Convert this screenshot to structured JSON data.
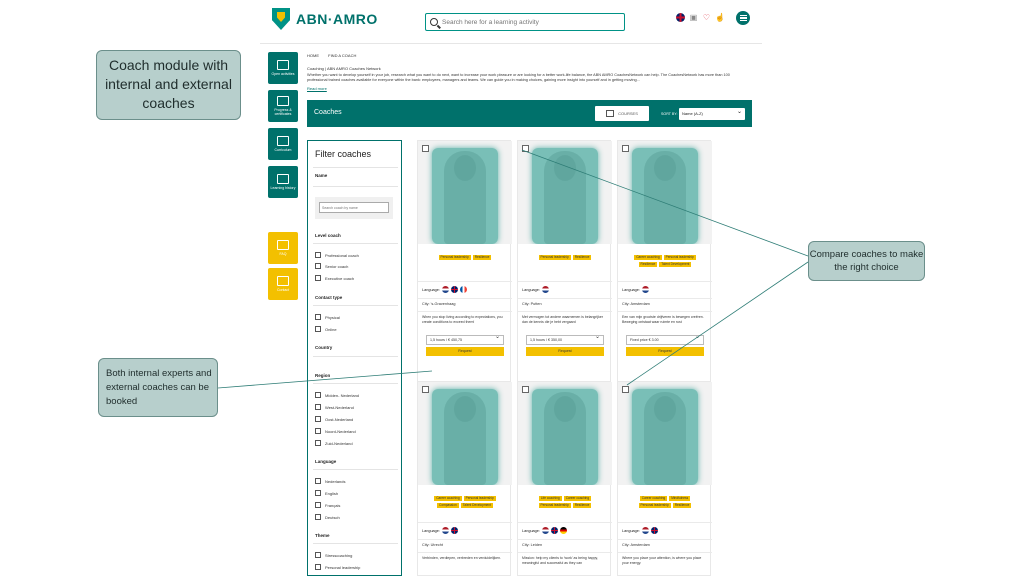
{
  "header": {
    "logo_text": "ABN·AMRO",
    "search_placeholder": "Search here for a learning activity"
  },
  "sidenav": [
    {
      "label": "Open activities"
    },
    {
      "label": "Progress & certificates"
    },
    {
      "label": "Curriculum"
    },
    {
      "label": "Learning history"
    },
    {
      "label": "FAQ"
    },
    {
      "label": "Contact"
    }
  ],
  "breadcrumb": [
    "HOME",
    "FIND A COACH"
  ],
  "intro": {
    "title": "Coaching | ABN AMRO Coaches Network",
    "text": "Whether you want to develop yourself in your job, research what you want to do next, want to increase your work pleasure or are looking for a better work-life balance, the ABN AMRO CoachesNetwork can help. The CoachesNetwork has more than 100 professional trained coaches available for everyone within the bank: employees, managers and teams. We can guide you in making choices, gaining more insight into yourself and in getting moving...",
    "read_more": "Read more"
  },
  "coaches_bar": {
    "title": "Coaches",
    "courses_label": "COURSES",
    "sort_label": "SORT BY:",
    "sort_value": "Name (A-Z)"
  },
  "filter": {
    "title": "Filter coaches",
    "name_label": "Name",
    "name_placeholder": "Search coach by name",
    "level_label": "Level coach",
    "level_options": [
      "Professional coach",
      "Senior coach",
      "Executive coach"
    ],
    "contact_label": "Contact type",
    "contact_options": [
      "Physical",
      "Online"
    ],
    "country_label": "Country",
    "region_label": "Region",
    "region_options": [
      "Midden- Nederland",
      "West-Nederland",
      "Oost-Nederland",
      "Noord-Nederland",
      "Zuid-Nederland"
    ],
    "language_label": "Language",
    "language_options": [
      "Nederlands",
      "English",
      "Français",
      "Deutsch"
    ],
    "theme_label": "Theme",
    "theme_options": [
      "Stresscoaching",
      "Personal leadership"
    ]
  },
  "cards": [
    {
      "tags": [
        "Personal leadership",
        "Resilience"
      ],
      "language_label": "Language:",
      "languages": [
        "nl",
        "en",
        "fr"
      ],
      "city": "City: 's-Gravenhaag",
      "desc": "When you stop living according to expectations, you create conditions to exceed them!",
      "price": "1,5 hours / € 450,75",
      "request": "Request"
    },
    {
      "tags": [
        "Personal leadership",
        "Resilience"
      ],
      "language_label": "Language:",
      "languages": [
        "nl"
      ],
      "city": "City: Putten",
      "desc": "Met vermogen tot andere waarnemen is belangrijker dan de kennis die je hebt vergaard",
      "price": "1,5 hours / € 350,00",
      "request": "Request"
    },
    {
      "tags": [
        "Career coaching",
        "Personal leadership",
        "Resilience",
        "Talent Development"
      ],
      "language_label": "Language:",
      "languages": [
        "nl"
      ],
      "city": "City: Amsterdam",
      "desc": "Een van mijn grootste drijfveren is bewegen creëren. Beweging ontstaat waar ruimte en rust",
      "price": "Fixed price € 3.00",
      "request": "Request"
    },
    {
      "tags": [
        "Career coaching",
        "Personal leadership",
        "Compassion",
        "Talent Development"
      ],
      "language_label": "Language:",
      "languages": [
        "nl",
        "en"
      ],
      "city": "City: Utrecht",
      "desc": "Verbinden, verdiepen, verbreden en verduidelijken.",
      "price": "",
      "request": ""
    },
    {
      "tags": [
        "Life coaching",
        "Career coaching",
        "Personal leadership",
        "Resilience"
      ],
      "language_label": "Language:",
      "languages": [
        "nl",
        "en",
        "de"
      ],
      "city": "City: Leiden",
      "desc": "Mission: help my clients to 'work' as being happy, meaningful and successful as they can",
      "price": "",
      "request": ""
    },
    {
      "tags": [
        "Career coaching",
        "Mindfulness",
        "Personal leadership",
        "Resilience"
      ],
      "language_label": "Language:",
      "languages": [
        "nl",
        "en"
      ],
      "city": "City: Amsterdam",
      "desc": "Where you place your attention, is where you place your energy.",
      "price": "",
      "request": ""
    }
  ],
  "callouts": {
    "coach_module": "Coach module with internal and external coaches",
    "compare": "Compare coaches to make the right choice",
    "both": "Both internal experts and external coaches can be booked"
  },
  "colors": {
    "brand_green": "#00716b",
    "brand_yellow": "#f3c000",
    "callout_bg": "#b7cfcc"
  }
}
